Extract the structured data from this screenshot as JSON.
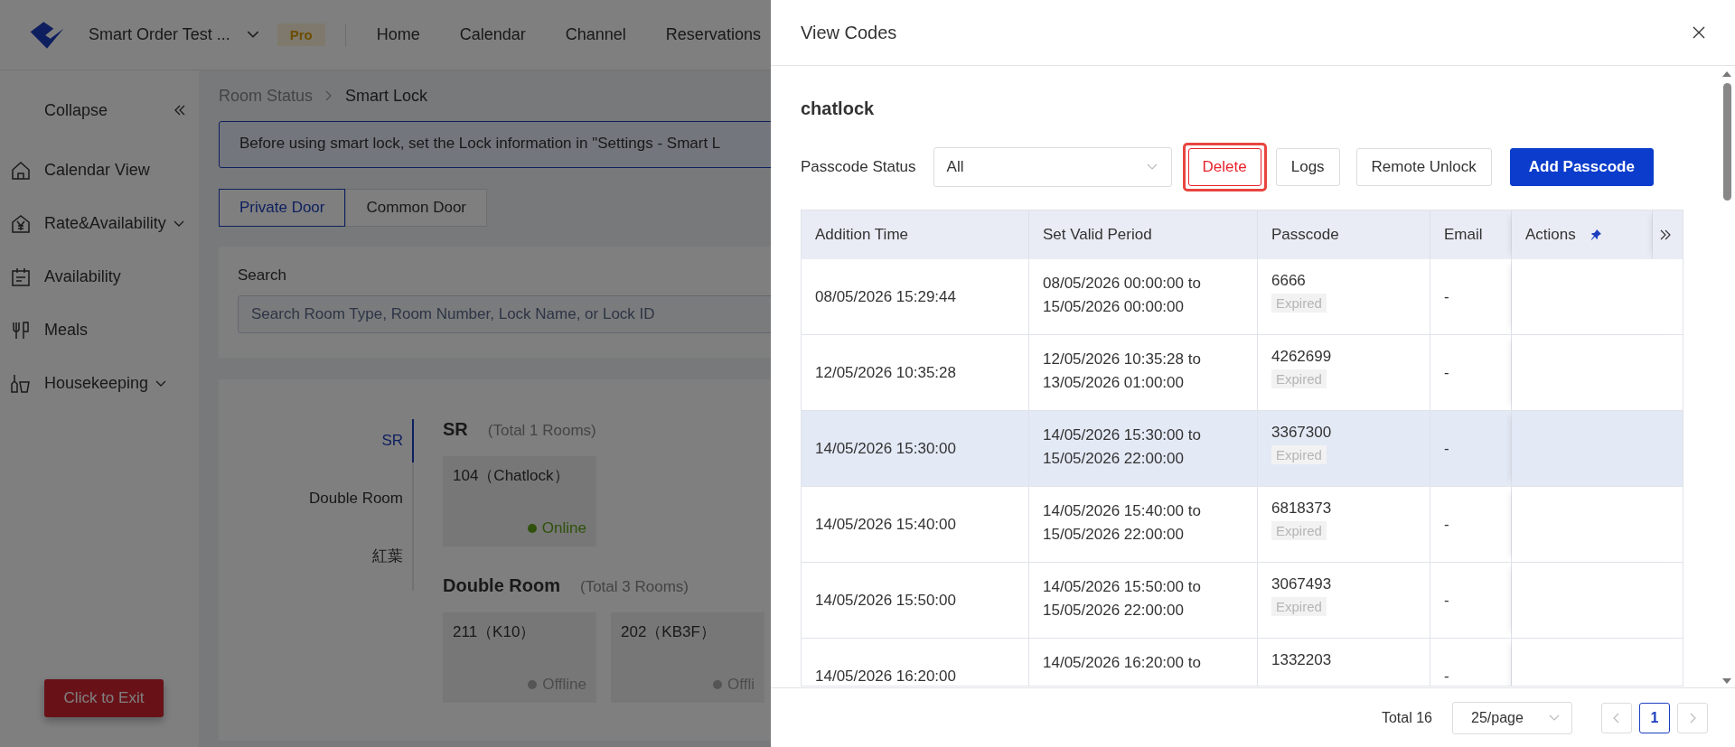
{
  "app_header": {
    "product": "Smart Order Test ...",
    "plan_badge": "Pro",
    "nav": [
      {
        "label": "Home"
      },
      {
        "label": "Calendar"
      },
      {
        "label": "Channel"
      },
      {
        "label": "Reservations"
      }
    ]
  },
  "sidebar": {
    "collapse": "Collapse",
    "items": [
      {
        "label": "Calendar View",
        "expandable": false
      },
      {
        "label": "Rate&Availability",
        "expandable": true
      },
      {
        "label": "Availability",
        "expandable": false
      },
      {
        "label": "Meals",
        "expandable": false
      },
      {
        "label": "Housekeeping",
        "expandable": true
      }
    ]
  },
  "exit_button": "Click to Exit",
  "breadcrumb": [
    "Room Status",
    "Smart Lock"
  ],
  "notice": "Before using smart lock, set the Lock information in \"Settings - Smart L",
  "door_tabs": [
    {
      "label": "Private Door",
      "selected": true
    },
    {
      "label": "Common Door",
      "selected": false
    }
  ],
  "search": {
    "label": "Search",
    "placeholder": "Search Room Type, Room Number, Lock Name, or Lock ID"
  },
  "room_type_nav": [
    {
      "label": "SR",
      "selected": true
    },
    {
      "label": "Double Room",
      "selected": false
    },
    {
      "label": "紅葉",
      "selected": false
    }
  ],
  "room_groups": [
    {
      "name": "SR",
      "total": "(Total 1 Rooms)",
      "rooms": [
        {
          "label": "104（Chatlock）",
          "status": "Online",
          "online": true
        }
      ]
    },
    {
      "name": "Double Room",
      "total": "(Total 3 Rooms)",
      "rooms": [
        {
          "label": "211（K10）",
          "status": "Offline",
          "online": false
        },
        {
          "label": "202（KB3F）",
          "status": "Offli",
          "online": false
        }
      ]
    }
  ],
  "drawer": {
    "title": "View Codes",
    "lock_name": "chatlock",
    "filter": {
      "label": "Passcode Status",
      "value": "All"
    },
    "buttons": [
      {
        "label": "Delete",
        "kind": "danger",
        "highlighted": true
      },
      {
        "label": "Logs",
        "kind": "default",
        "highlighted": false
      },
      {
        "label": "Remote Unlock",
        "kind": "default",
        "highlighted": false
      },
      {
        "label": "Add Passcode",
        "kind": "primary",
        "highlighted": false
      }
    ],
    "table": {
      "columns": [
        "Addition Time",
        "Set Valid Period",
        "Passcode",
        "Email",
        "Actions"
      ],
      "rows": [
        {
          "added": "08/05/2026 15:29:44",
          "valid_period": "08/05/2026 00:00:00 to 15/05/2026 00:00:00",
          "passcode": "6666",
          "status": "Expired",
          "email": "-",
          "selected": false
        },
        {
          "added": "12/05/2026 10:35:28",
          "valid_period": "12/05/2026 10:35:28 to 13/05/2026 01:00:00",
          "passcode": "4262699",
          "status": "Expired",
          "email": "-",
          "selected": false
        },
        {
          "added": "14/05/2026 15:30:00",
          "valid_period": "14/05/2026 15:30:00 to 15/05/2026 22:00:00",
          "passcode": "3367300",
          "status": "Expired",
          "email": "-",
          "selected": true
        },
        {
          "added": "14/05/2026 15:40:00",
          "valid_period": "14/05/2026 15:40:00 to 15/05/2026 22:00:00",
          "passcode": "6818373",
          "status": "Expired",
          "email": "-",
          "selected": false
        },
        {
          "added": "14/05/2026 15:50:00",
          "valid_period": "14/05/2026 15:50:00 to 15/05/2026 22:00:00",
          "passcode": "3067493",
          "status": "Expired",
          "email": "-",
          "selected": false
        },
        {
          "added": "14/05/2026 16:20:00",
          "valid_period": "14/05/2026 16:20:00 to",
          "passcode": "1332203",
          "email": "-",
          "selected": false
        }
      ]
    },
    "pagination": {
      "total": "Total 16",
      "page_size": "25/page",
      "pages": [
        {
          "label": "1",
          "selected": true
        }
      ]
    }
  }
}
